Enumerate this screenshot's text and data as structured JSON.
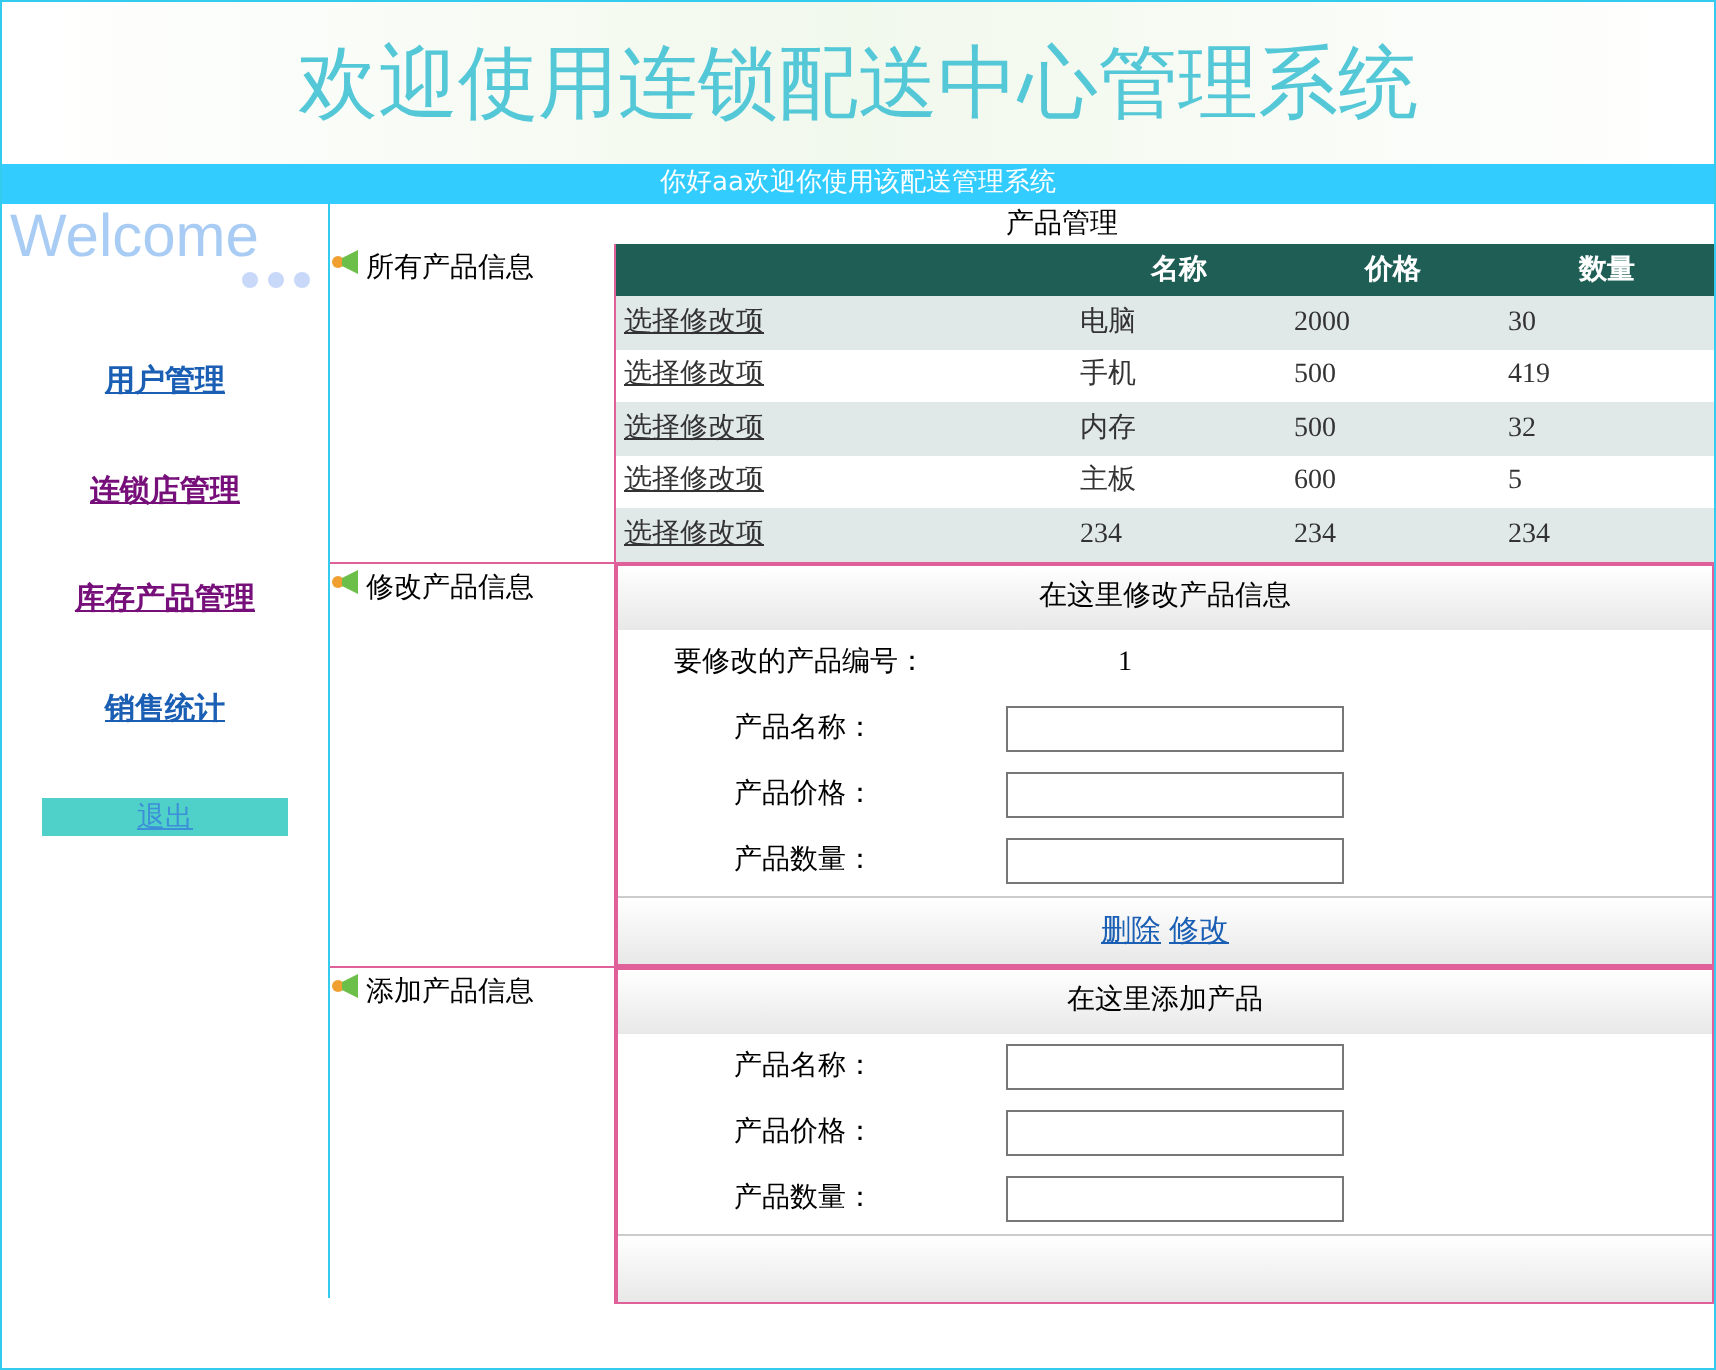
{
  "header": {
    "title": "欢迎使用连锁配送中心管理系统"
  },
  "greeting_bar": {
    "text": "你好aa欢迎你使用该配送管理系统"
  },
  "sidebar": {
    "welcome": "Welcome",
    "items": [
      {
        "label": "用户管理",
        "visited": false
      },
      {
        "label": "连锁店管理",
        "visited": true
      },
      {
        "label": "库存产品管理",
        "visited": true
      },
      {
        "label": "销售统计",
        "visited": false
      }
    ],
    "logout": "退出"
  },
  "page_title": "产品管理",
  "sections": [
    {
      "kind": "table",
      "label": "所有产品信息",
      "columns": [
        "名称",
        "价格",
        "数量"
      ],
      "rows": [
        {
          "link": "选择修改项",
          "cells": [
            "电脑",
            "2000",
            "30"
          ]
        },
        {
          "link": "选择修改项",
          "cells": [
            "手机",
            "500",
            "419"
          ]
        },
        {
          "link": "选择修改项",
          "cells": [
            "内存",
            "500",
            "32"
          ]
        },
        {
          "link": "选择修改项",
          "cells": [
            "主板",
            "600",
            "5"
          ]
        },
        {
          "link": "选择修改项",
          "cells": [
            "234",
            "234",
            "234"
          ]
        }
      ]
    },
    {
      "kind": "form",
      "label": "修改产品信息",
      "title": "在这里修改产品信息",
      "id_label": "要修改的产品编号：",
      "id_value": "1",
      "fields": [
        {
          "label": "产品名称："
        },
        {
          "label": "产品价格："
        },
        {
          "label": "产品数量："
        }
      ],
      "actions": [
        "删除",
        "修改"
      ]
    },
    {
      "kind": "form",
      "label": "添加产品信息",
      "title": "在这里添加产品",
      "fields": [
        {
          "label": "产品名称："
        },
        {
          "label": "产品价格："
        },
        {
          "label": "产品数量："
        }
      ]
    }
  ]
}
